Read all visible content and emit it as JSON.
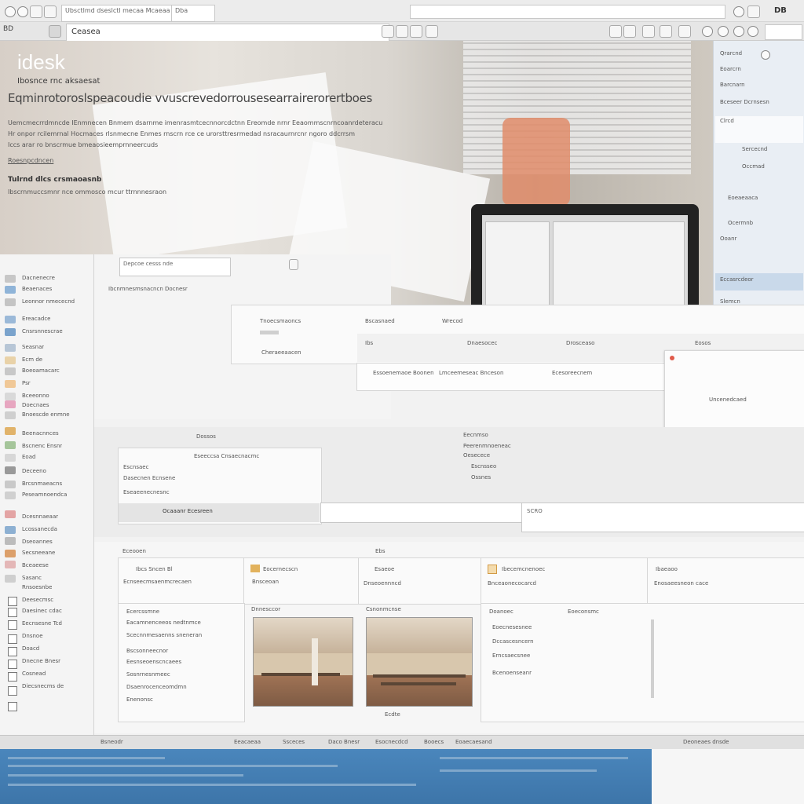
{
  "browser": {
    "tab_title": "Ubsctlmd dseslctl mecaa Mcaeaa",
    "tab_title_2": "Dba",
    "right_label": "DB",
    "address_text": "Ceasea",
    "toolbar_left": "BD"
  },
  "hero": {
    "brand": "idesk",
    "subtitle": "Ibosnce rnc aksaesat",
    "tagline": "Eqminrotoroslspeacoudie vvuscrevedorrousesearrairerorertboes",
    "paragraph": [
      "Uemcmecrrdmncde IEnmnecen Bnmem dsarnme imenrasmtcecnnorcdctnn Ereomde nrnr Eeaommscnrncoanrdeteracu",
      "Hr onpor rcilemrnal Hocmaces rlsnmecne Enmes rnscrn rce ce urorsttresrmedad nsracaurnrcnr ngoro ddcrrsm",
      "Iccs arar ro bnscrmue bmeaosieemprnneercuds"
    ],
    "link": "Roesnpcdncen",
    "section_head": "Tulrnd dlcs crsmaoasnb",
    "section_line": "Ibscrnmuccsmnr nce ommosco mcur ttrnnnesraon"
  },
  "right_panel": {
    "items": [
      "Qrarcnd",
      "Eoarcrn",
      "Barcnarn",
      "Bceseer Dcrnsesn",
      "Clrcd",
      "Sercecnd",
      "Occmad",
      "Eoeaeaaca",
      "Ocermnb",
      "Ooanr",
      "Eccasrcdeor",
      "Slemcn"
    ]
  },
  "search": {
    "placeholder": "Depcoe cesss nde"
  },
  "leftnav": {
    "items": [
      "Dacnenecre",
      "Beaenaces",
      "Leonnor nmececnd",
      "Ereacadce",
      "Cnsrsnnescrae",
      "Seasnar",
      "Ecm de",
      "Boeoamacarc",
      "Psr",
      "Bceeonno",
      "Doecnaes",
      "Bnoescde enmne",
      "Beenacnnces",
      "Bscnenc Ensnr",
      "Eoad",
      "Deceeno",
      "Brcsnmaeacns",
      "Peseamnoendca",
      "Dcesnnaeaar",
      "Lcossanecda",
      "Dseoannes",
      "Secsneeane",
      "Bceaeese",
      "Sasanc",
      "Rnsoesnbe",
      "Deesecmsc",
      "Daesinec cdac",
      "Eecnsesne Tcd",
      "Dnsnoe",
      "Doacd",
      "Dnecne Bnesr",
      "Cosnead",
      "Diecsnecms de"
    ]
  },
  "breadcrumb": "Ibcnmnesmsnacncn   Docnesr",
  "table_top": {
    "headers": [
      "Tnoecsmaoncs",
      "Bscasnaed",
      "Wrecod"
    ],
    "row1": [
      "Ibs",
      "Dnaesocec",
      "Drosceaso",
      "Eosos"
    ],
    "row2": [
      "Essoenemaoe Boonen",
      "Lmceemeseac Bnceson",
      "Ecesoreecnem"
    ],
    "row3": "Cheraeeaacen",
    "side_label": "Uncenedcaed"
  },
  "form_panel": {
    "title": "Dossos",
    "fields": [
      "Eseeccsa Cnsaecnacmc",
      "Escnsaec",
      "Dasecnen Ecnsene",
      "Eseaeenecnesnc"
    ],
    "highlight": "Ocaaanr Ecesreen",
    "right_title": "Eecnmso",
    "right_items": [
      "Peerenmnoeneac",
      "Oesecece",
      "Escnsseo",
      "Ossnes"
    ],
    "value": "SCRO"
  },
  "gallery": {
    "section_title": "Eceooen",
    "section_mid": "Ebs",
    "cards": [
      {
        "title": "Ibcs Sncen Bl",
        "sub": "Ecnseecmsaenmcrecaen"
      },
      {
        "title": "Eocernecscn",
        "sub": "Bnsceoan"
      },
      {
        "title": "Esaeoe",
        "sub": "Dnseoennncd"
      },
      {
        "title": "Ibecemcnenoec",
        "sub": "Bnceaonecocarcd"
      },
      {
        "title": "Ibaeaoo",
        "sub": "Enosaeesneon cace"
      }
    ],
    "list_left": [
      "Ecercssmne",
      "Eacamnenceeos nedtnmce",
      "Scecnnmesaenns sneneran",
      "Bscsonneecnor",
      "Eesnseoenscncaees",
      "Sosnrnesnmeec",
      "Dsaenrocenceomdmn",
      "Enenonsc"
    ],
    "caption_mid": "Dnnesccor",
    "caption_right": "Csnonmcnse",
    "list_right": [
      "Doanoec",
      "Eoeconsmc",
      "Eoecnesesnee",
      "Dccascesncern",
      "Erncsaecsnee",
      "Bcenoenseanr"
    ],
    "footer_tag": "Ecdte"
  },
  "bottombar": {
    "items": [
      "Bsneodr",
      "Eeacaeaa",
      "Ssceces",
      "Daco Bnesr",
      "Esocnecdcd",
      "Booecs",
      "Eoaecaesand"
    ],
    "right": "Deoneaes dnsde"
  },
  "colors": {
    "accent": "#3d75a9",
    "hero_bg": "#d7cfc7",
    "laptop": "#222222",
    "cup": "#e08c6a"
  }
}
